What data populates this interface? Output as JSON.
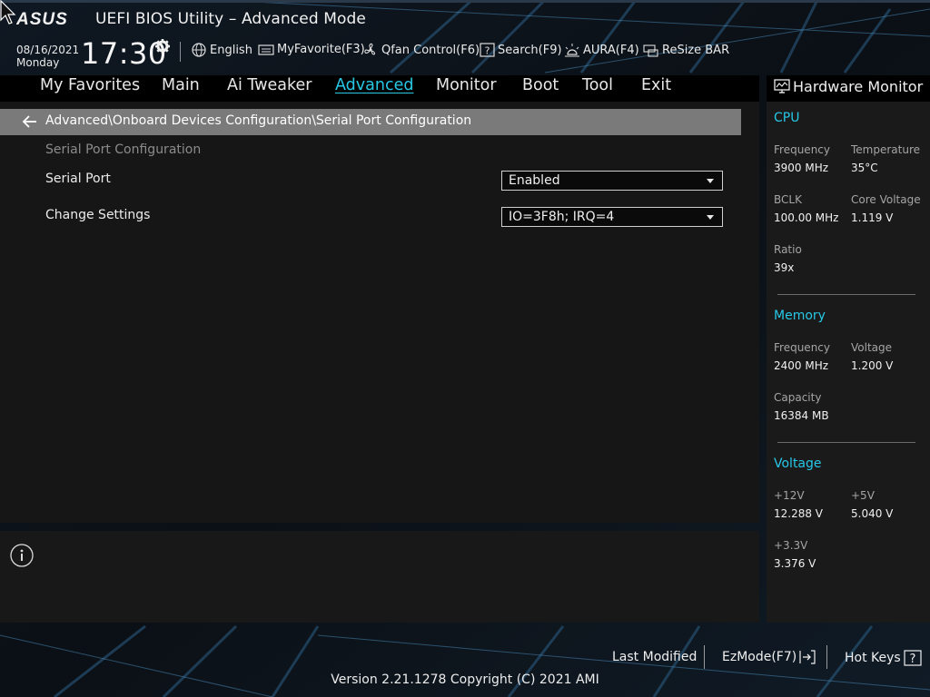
{
  "header": {
    "brand": "ASUS",
    "title": "UEFI BIOS Utility – Advanced Mode",
    "date": "08/16/2021",
    "day": "Monday",
    "time": "17:30",
    "tools": [
      {
        "label": "English",
        "icon": "globe-icon"
      },
      {
        "label": "MyFavorite(F3)",
        "icon": "keyboard-icon"
      },
      {
        "label": "Qfan Control(F6)",
        "icon": "fan-icon"
      },
      {
        "label": "Search(F9)",
        "icon": "question-box-icon"
      },
      {
        "label": "AURA(F4)",
        "icon": "aura-light-icon"
      },
      {
        "label": "ReSize BAR",
        "icon": "resize-bar-icon"
      }
    ]
  },
  "menu": {
    "items": [
      "My Favorites",
      "Main",
      "Ai Tweaker",
      "Advanced",
      "Monitor",
      "Boot",
      "Tool",
      "Exit"
    ],
    "active": "Advanced"
  },
  "breadcrumb": "Advanced\\Onboard Devices Configuration\\Serial Port Configuration",
  "page": {
    "section_title": "Serial Port Configuration",
    "settings": [
      {
        "label": "Serial Port",
        "value": "Enabled"
      },
      {
        "label": "Change Settings",
        "value": "IO=3F8h; IRQ=4"
      }
    ]
  },
  "hardware_monitor": {
    "title": "Hardware Monitor",
    "cpu": {
      "heading": "CPU",
      "frequency_label": "Frequency",
      "frequency": "3900 MHz",
      "temperature_label": "Temperature",
      "temperature": "35°C",
      "bclk_label": "BCLK",
      "bclk": "100.00 MHz",
      "core_voltage_label": "Core Voltage",
      "core_voltage": "1.119 V",
      "ratio_label": "Ratio",
      "ratio": "39x"
    },
    "memory": {
      "heading": "Memory",
      "frequency_label": "Frequency",
      "frequency": "2400 MHz",
      "voltage_label": "Voltage",
      "voltage": "1.200 V",
      "capacity_label": "Capacity",
      "capacity": "16384 MB"
    },
    "voltage": {
      "heading": "Voltage",
      "v12_label": "+12V",
      "v12": "12.288 V",
      "v5_label": "+5V",
      "v5": "5.040 V",
      "v33_label": "+3.3V",
      "v33": "3.376 V"
    }
  },
  "footer": {
    "last_modified": "Last Modified",
    "ezmode": "EzMode(F7)",
    "hot_keys": "Hot Keys",
    "version": "Version 2.21.1278 Copyright (C) 2021 AMI"
  },
  "colors": {
    "accent": "#27c8e6",
    "breadcrumb_bg": "#7a7a7a",
    "panel_bg": "#161616"
  }
}
